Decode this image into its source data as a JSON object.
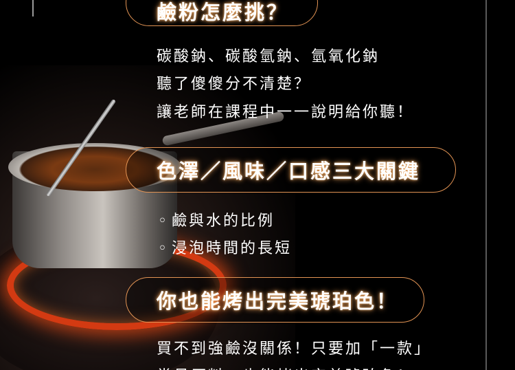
{
  "header": {
    "title_tail": "鹼粉怎麼挑？"
  },
  "intro": {
    "lines": [
      "碳酸鈉、碳酸氫鈉、氫氧化鈉",
      "聽了傻傻分不清楚？",
      "讓老師在課程中一一說明給你聽！"
    ]
  },
  "section_key": {
    "title": "色澤／風味／口感三大關鍵"
  },
  "bullets": {
    "marker": "◦",
    "items": [
      "鹼與水的比例",
      "浸泡時間的長短"
    ]
  },
  "section_amber": {
    "title": "你也能烤出完美琥珀色！"
  },
  "outro": {
    "lines": [
      "買不到強鹼沒關係！只要加「一款」",
      "常見原料，也能烤出完美琥珀色！"
    ]
  },
  "colors": {
    "accent": "#e39454",
    "background": "#000000",
    "text": "#ffffff"
  }
}
